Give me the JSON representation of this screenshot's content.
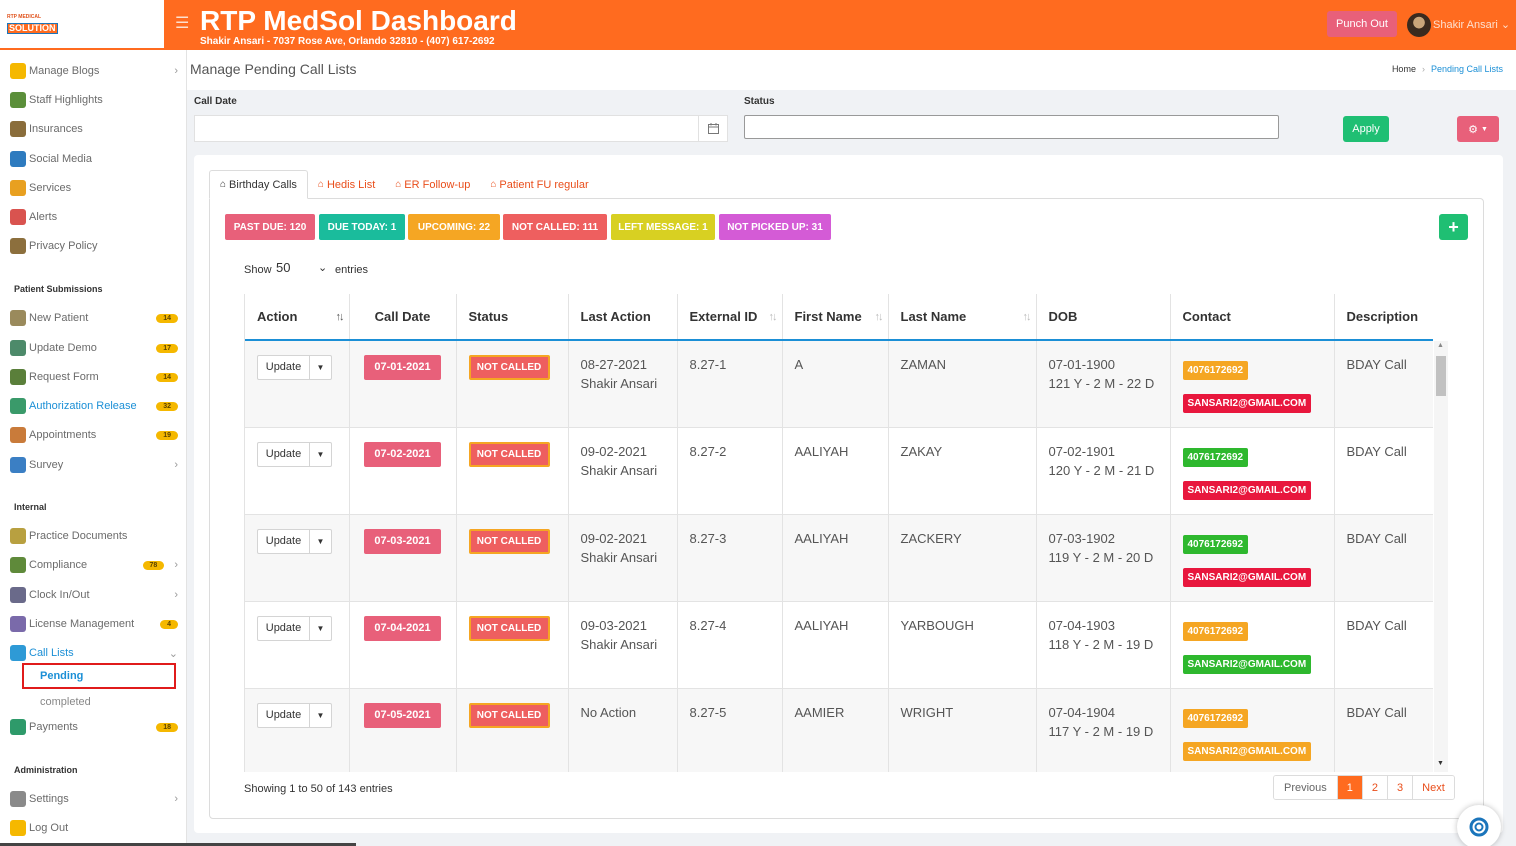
{
  "brand": {
    "logo_top": "RTP MEDICAL",
    "logo_bottom": "SOLUTION"
  },
  "header": {
    "title": "RTP MedSol Dashboard",
    "subtitle": "Shakir Ansari - 7037 Rose Ave, Orlando 32810 - (407) 617-2692",
    "punch_label": "Punch Out",
    "user_name": "Shakir Ansari",
    "accent": "#ff6b1f"
  },
  "sidebar": {
    "items_top": [
      {
        "label": "Manage Blogs",
        "icon": "blog-icon",
        "chevron": true
      },
      {
        "label": "Staff Highlights",
        "icon": "staff-icon"
      },
      {
        "label": "Insurances",
        "icon": "insurance-icon"
      },
      {
        "label": "Social Media",
        "icon": "social-media-icon"
      },
      {
        "label": "Services",
        "icon": "services-icon"
      },
      {
        "label": "Alerts",
        "icon": "alert-icon"
      },
      {
        "label": "Privacy Policy",
        "icon": "privacy-icon"
      }
    ],
    "section_patient": "Patient Submissions",
    "items_patient": [
      {
        "label": "New Patient",
        "badge": "14",
        "icon": "new-patient-icon"
      },
      {
        "label": "Update Demo",
        "badge": "17",
        "icon": "update-demo-icon"
      },
      {
        "label": "Request Form",
        "badge": "14",
        "icon": "request-form-icon"
      },
      {
        "label": "Authorization Release",
        "badge": "32",
        "icon": "authorization-icon"
      },
      {
        "label": "Appointments",
        "badge": "19",
        "icon": "appointments-icon"
      },
      {
        "label": "Survey",
        "icon": "survey-icon",
        "chevron": true
      }
    ],
    "section_internal": "Internal",
    "items_internal": [
      {
        "label": "Practice Documents",
        "icon": "documents-icon"
      },
      {
        "label": "Compliance",
        "badge": "78",
        "icon": "compliance-icon",
        "chevron": true
      },
      {
        "label": "Clock In/Out",
        "icon": "clock-icon",
        "chevron": true
      },
      {
        "label": "License Management",
        "badge": "4",
        "icon": "license-icon"
      },
      {
        "label": "Call Lists",
        "icon": "call-lists-icon",
        "chevron_down": true
      }
    ],
    "call_sub": {
      "pending": "Pending",
      "completed": "completed"
    },
    "payments": {
      "label": "Payments",
      "badge": "18"
    },
    "section_admin": "Administration",
    "settings": "Settings",
    "logout": "Log Out"
  },
  "page": {
    "title": "Manage Pending Call Lists",
    "breadcrumb_home": "Home",
    "breadcrumb_current": "Pending Call Lists"
  },
  "filters": {
    "call_date_label": "Call Date",
    "call_date_value": "",
    "status_label": "Status",
    "status_value": "",
    "apply_label": "Apply"
  },
  "tabs": [
    "Birthday Calls",
    "Hedis List",
    "ER Follow-up",
    "Patient FU regular"
  ],
  "status_pills": [
    {
      "label": "PAST DUE: 120",
      "color": "#e8607a"
    },
    {
      "label": "DUE TODAY: 1",
      "color": "#1abc9c"
    },
    {
      "label": "UPCOMING: 22",
      "color": "#f5a623"
    },
    {
      "label": "NOT CALLED: 111",
      "color": "#ee5f5f"
    },
    {
      "label": "LEFT MESSAGE: 1",
      "color": "#d8d022"
    },
    {
      "label": "NOT PICKED UP: 31",
      "color": "#d45bd6"
    }
  ],
  "length_menu": {
    "show": "Show",
    "value": "50",
    "entries": "entries"
  },
  "table": {
    "columns": [
      "Action",
      "Call Date",
      "Status",
      "Last Action",
      "External ID",
      "First Name",
      "Last Name",
      "DOB",
      "Contact",
      "Description"
    ],
    "action_label": "Update",
    "rows": [
      {
        "call_date": "07-01-2021",
        "status": "NOT CALLED",
        "last_action_1": "08-27-2021",
        "last_action_2": "Shakir Ansari",
        "external_id": "8.27-1",
        "first": "A",
        "last": "ZAMAN",
        "dob": "07-01-1900",
        "age": "121 Y - 2 M - 22 D",
        "phone": "4076172692",
        "phone_color": "orange",
        "email": "SANSARI2@GMAIL.COM",
        "email_color": "red",
        "desc": "BDAY Call"
      },
      {
        "call_date": "07-02-2021",
        "status": "NOT CALLED",
        "last_action_1": "09-02-2021",
        "last_action_2": "Shakir Ansari",
        "external_id": "8.27-2",
        "first": "AALIYAH",
        "last": "ZAKAY",
        "dob": "07-02-1901",
        "age": "120 Y - 2 M - 21 D",
        "phone": "4076172692",
        "phone_color": "green",
        "email": "SANSARI2@GMAIL.COM",
        "email_color": "red",
        "desc": "BDAY Call"
      },
      {
        "call_date": "07-03-2021",
        "status": "NOT CALLED",
        "last_action_1": "09-02-2021",
        "last_action_2": "Shakir Ansari",
        "external_id": "8.27-3",
        "first": "AALIYAH",
        "last": "ZACKERY",
        "dob": "07-03-1902",
        "age": "119 Y - 2 M - 20 D",
        "phone": "4076172692",
        "phone_color": "green",
        "email": "SANSARI2@GMAIL.COM",
        "email_color": "red",
        "desc": "BDAY Call"
      },
      {
        "call_date": "07-04-2021",
        "status": "NOT CALLED",
        "last_action_1": "09-03-2021",
        "last_action_2": "Shakir Ansari",
        "external_id": "8.27-4",
        "first": "AALIYAH",
        "last": "YARBOUGH",
        "dob": "07-04-1903",
        "age": "118 Y - 2 M - 19 D",
        "phone": "4076172692",
        "phone_color": "orange",
        "email": "SANSARI2@GMAIL.COM",
        "email_color": "green",
        "desc": "BDAY Call"
      },
      {
        "call_date": "07-05-2021",
        "status": "NOT CALLED",
        "last_action_1": "No Action",
        "last_action_2": "",
        "external_id": "8.27-5",
        "first": "AAMIER",
        "last": "WRIGHT",
        "dob": "07-04-1904",
        "age": "117 Y - 2 M - 19 D",
        "phone": "4076172692",
        "phone_color": "orange",
        "email": "SANSARI2@GMAIL.COM",
        "email_color": "orange",
        "desc": "BDAY Call"
      }
    ]
  },
  "footer": {
    "showing": "Showing 1 to 50 of 143 entries",
    "previous": "Previous",
    "pages": [
      "1",
      "2",
      "3"
    ],
    "next": "Next"
  }
}
